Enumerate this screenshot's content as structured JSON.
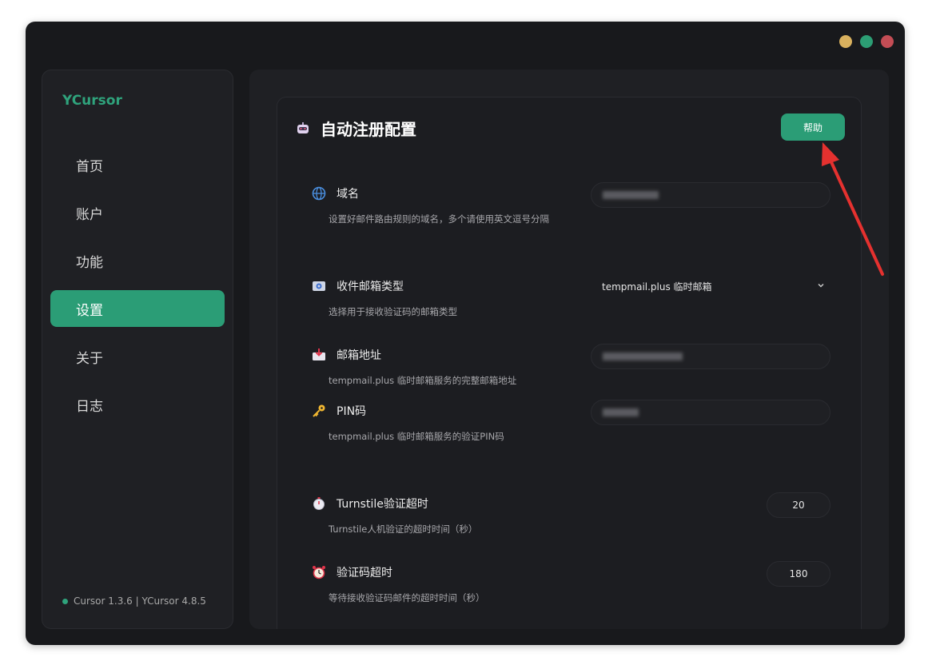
{
  "app": {
    "name": "YCursor",
    "brand_color": "#2fa37c"
  },
  "window_controls": {
    "colors": [
      "#d9b15e",
      "#2c9e74",
      "#c44d55"
    ]
  },
  "sidebar": {
    "items": [
      {
        "label": "首页",
        "active": false
      },
      {
        "label": "账户",
        "active": false
      },
      {
        "label": "功能",
        "active": false
      },
      {
        "label": "设置",
        "active": true
      },
      {
        "label": "关于",
        "active": false
      },
      {
        "label": "日志",
        "active": false
      }
    ],
    "active_color": "#2b9d76",
    "version_text": "Cursor 1.3.6 | YCursor 4.8.5",
    "status_color": "#2fa37c"
  },
  "card": {
    "title": "自动注册配置",
    "icon": "robot-icon",
    "help_label": "帮助",
    "help_color": "#2b9d76",
    "annotation_arrow_color": "#e5312f"
  },
  "settings": {
    "domain": {
      "label": "域名",
      "desc": "设置好邮件路由规则的域名，多个请使用英文逗号分隔",
      "icon": "globe-icon"
    },
    "mailbox_type": {
      "label": "收件邮箱类型",
      "desc": "选择用于接收验证码的邮箱类型",
      "value": "tempmail.plus 临时邮箱",
      "icon": "mailbox-icon"
    },
    "email_address": {
      "label": "邮箱地址",
      "desc": "tempmail.plus 临时邮箱服务的完整邮箱地址",
      "icon": "inbox-icon"
    },
    "pin": {
      "label": "PIN码",
      "desc": "tempmail.plus 临时邮箱服务的验证PIN码",
      "icon": "key-icon"
    },
    "turnstile_timeout": {
      "label": "Turnstile验证超时",
      "desc": "Turnstile人机验证的超时时间（秒）",
      "value": "20",
      "icon": "stopwatch-icon"
    },
    "code_timeout": {
      "label": "验证码超时",
      "desc": "等待接收验证码邮件的超时时间（秒）",
      "value": "180",
      "icon": "alarm-clock-icon"
    }
  }
}
